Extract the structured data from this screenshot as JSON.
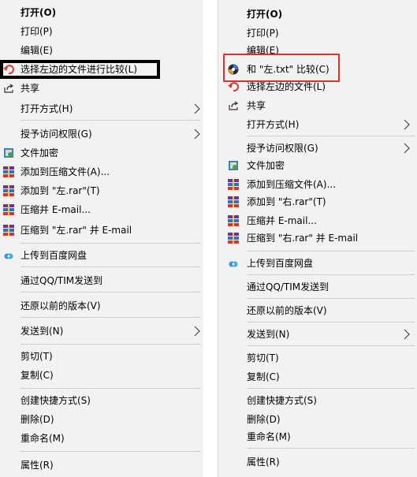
{
  "left_menu": {
    "open": "打开(O)",
    "print": "打印(P)",
    "edit": "编辑(E)",
    "compare": "选择左边的文件进行比较(L)",
    "share": "共享",
    "open_with": "打开方式(H)",
    "grant_access": "授予访问权限(G)",
    "encrypt": "文件加密",
    "add_archive": "添加到压缩文件(A)...",
    "add_rar": "添加到 \"左.rar\"(T)",
    "compress_email": "压缩并 E-mail...",
    "compress_rar_email": "压缩到 \"左.rar\" 并 E-mail",
    "upload_baidu": "上传到百度网盘",
    "send_qq": "通过QQ/TIM发送到",
    "restore": "还原以前的版本(V)",
    "send_to": "发送到(N)",
    "cut": "剪切(T)",
    "copy": "复制(C)",
    "shortcut": "创建快捷方式(S)",
    "delete": "删除(D)",
    "rename": "重命名(M)",
    "properties": "属性(R)"
  },
  "right_menu": {
    "open": "打开(O)",
    "print": "打印(P)",
    "edit": "编辑(E)",
    "compare_with": "和 \"左.txt\" 比较(C)",
    "compare_left": "选择左边的文件(L)",
    "share": "共享",
    "open_with": "打开方式(H)",
    "grant_access": "授予访问权限(G)",
    "encrypt": "文件加密",
    "add_archive": "添加到压缩文件(A)...",
    "add_rar": "添加到 \"右.rar\"(T)",
    "compress_email": "压缩并 E-mail...",
    "compress_rar_email": "压缩到 \"右.rar\" 并 E-mail",
    "upload_baidu": "上传到百度网盘",
    "send_qq": "通过QQ/TIM发送到",
    "restore": "还原以前的版本(V)",
    "send_to": "发送到(N)",
    "cut": "剪切(T)",
    "copy": "复制(C)",
    "shortcut": "创建快捷方式(S)",
    "delete": "删除(D)",
    "rename": "重命名(M)",
    "properties": "属性(R)"
  },
  "colors": {
    "highlight_black": "#000000",
    "highlight_red": "#e0302a",
    "menu_bg": "#f2f2f2"
  }
}
